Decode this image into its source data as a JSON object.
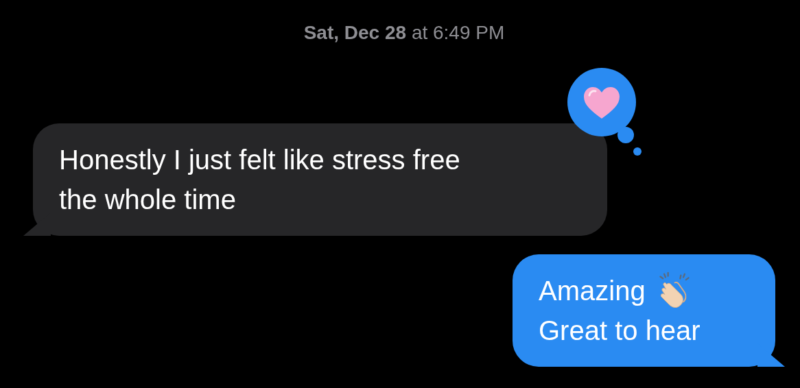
{
  "timestamp": "**Sat, Dec 28** at 6:49 PM",
  "messages": [
    {
      "kind": "received",
      "lines": [
        {
          "kind": "text",
          "text": "Honestly I just felt like stress free"
        },
        {
          "kind": "text",
          "text": "the whole time"
        }
      ],
      "reaction": {
        "kind": "heart"
      }
    },
    {
      "kind": "sent",
      "lines": [
        {
          "kind": "text_with_clap",
          "text": "Amazing"
        },
        {
          "kind": "text",
          "text": "Great to hear"
        }
      ]
    }
  ]
}
